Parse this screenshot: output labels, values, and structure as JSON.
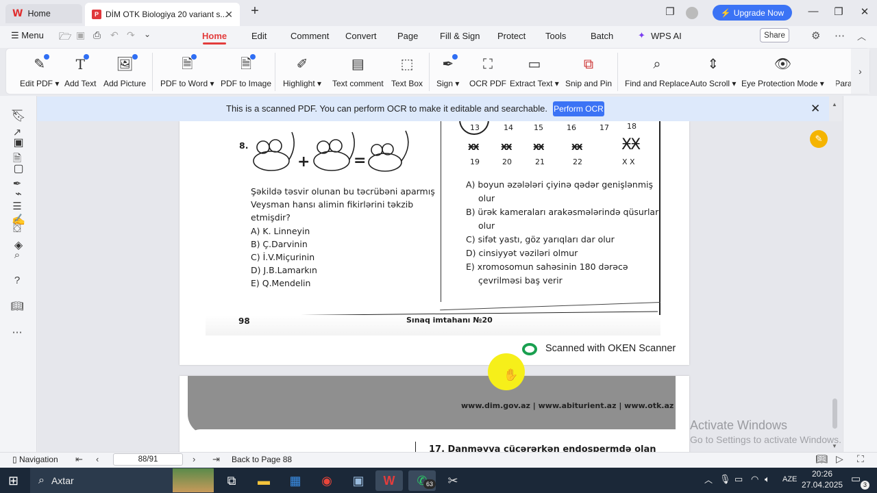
{
  "tabs": {
    "home": "Home",
    "document": "DİM OTK Biologiya 20 variant s..."
  },
  "window": {
    "upgrade": "Upgrade Now"
  },
  "menubar": {
    "menu": "Menu",
    "items": [
      "Home",
      "Edit",
      "Comment",
      "Convert",
      "Page",
      "Fill & Sign",
      "Protect",
      "Tools",
      "Batch",
      "WPS AI"
    ],
    "share": "Share"
  },
  "ribbon": {
    "edit_pdf": "Edit PDF",
    "add_text": "Add Text",
    "add_picture": "Add Picture",
    "pdf_to_word": "PDF to Word",
    "pdf_to_image": "PDF to Image",
    "highlight": "Highlight",
    "text_comment": "Text comment",
    "text_box": "Text Box",
    "sign": "Sign",
    "ocr_pdf": "OCR PDF",
    "extract_text": "Extract Text",
    "snip_pin": "Snip and Pin",
    "find_replace": "Find and Replace",
    "auto_scroll": "Auto Scroll",
    "eye_protection": "Eye Protection Mode",
    "para": "Para"
  },
  "notice": {
    "text": "This is a scanned PDF. You can perform OCR to make it editable and searchable.",
    "button": "Perform OCR"
  },
  "page1": {
    "q_number": "8.",
    "question": [
      "Şəkildə təsvir olunan bu təcrübəni aparmış",
      "Veysman hansı alimin fikirlərini təkzib",
      "etmişdir?"
    ],
    "options_left": [
      "A) K. Linneyin",
      "B) Ç.Darvinin",
      "C) İ.V.Miçurinin",
      "D) J.B.Lamarkın",
      "E) Q.Mendelin"
    ],
    "chrom_top": [
      "13",
      "14",
      "15",
      "16",
      "17",
      "18"
    ],
    "chrom_bottom": [
      "19",
      "20",
      "21",
      "22",
      "X X"
    ],
    "options_right": [
      "A) boyun əzələləri çiyinə qədər genişlənmiş",
      "olur",
      "B) ürək kameraları arakəsmələrində qüsurlar",
      "olur",
      "C) sifət yastı, göz yarıqları dar olur",
      "D) cinsiyyət vəziləri olmur",
      "E) xromosomun sahəsinin 180 dərəcə",
      "çevrilməsi baş verir"
    ],
    "page_number": "98",
    "footer": "Sınaq imtahanı №20",
    "scanner": "Scanned with OKEN Scanner"
  },
  "page2": {
    "sites": "www.dim.gov.az | www.abiturient.az | www.otk.az",
    "q17": "17. Danməyva çücərərkən endospermdə olan"
  },
  "watermark": {
    "line1": "Activate Windows",
    "line2": "Go to Settings to activate Windows."
  },
  "status": {
    "navigation": "Navigation",
    "page_field": "88/91",
    "back": "Back to Page 88"
  },
  "taskbar": {
    "search": "Axtar",
    "whatsapp_badge": "63",
    "lang": "AZE",
    "time": "20:26",
    "date": "27.04.2025",
    "notif": "3"
  }
}
